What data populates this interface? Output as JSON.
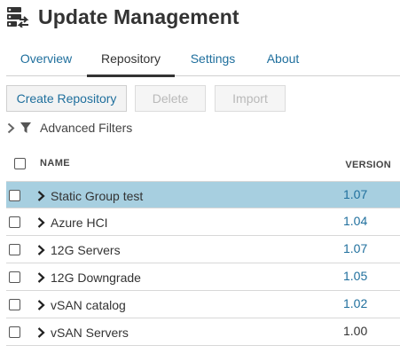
{
  "page": {
    "title": "Update Management"
  },
  "tabs": [
    {
      "label": "Overview",
      "active": false
    },
    {
      "label": "Repository",
      "active": true
    },
    {
      "label": "Settings",
      "active": false
    },
    {
      "label": "About",
      "active": false
    }
  ],
  "toolbar": {
    "create_label": "Create Repository",
    "delete_label": "Delete",
    "import_label": "Import"
  },
  "filters": {
    "label": "Advanced Filters"
  },
  "table": {
    "columns": {
      "name": "NAME",
      "version": "VERSION"
    },
    "rows": [
      {
        "name": "Static Group test",
        "version": "1.07",
        "selected": true,
        "version_link": true
      },
      {
        "name": "Azure HCI",
        "version": "1.04",
        "selected": false,
        "version_link": true
      },
      {
        "name": "12G Servers",
        "version": "1.07",
        "selected": false,
        "version_link": true
      },
      {
        "name": "12G Downgrade",
        "version": "1.05",
        "selected": false,
        "version_link": true
      },
      {
        "name": "vSAN catalog",
        "version": "1.02",
        "selected": false,
        "version_link": true
      },
      {
        "name": "vSAN Servers",
        "version": "1.00",
        "selected": false,
        "version_link": false
      }
    ]
  },
  "colors": {
    "accent": "#1f6f9d",
    "selected_row": "#a7cfe0",
    "text": "#333333"
  },
  "icons": {
    "header": "update-management-icon",
    "filter": "funnel-icon",
    "expand": "chevron-right-icon"
  }
}
